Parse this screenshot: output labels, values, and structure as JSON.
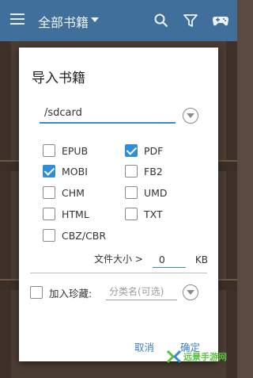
{
  "appbar": {
    "title": "全部书籍",
    "icons": [
      "menu-icon",
      "search-icon",
      "filter-icon",
      "gamepad-icon"
    ],
    "color": "#3f6f9a"
  },
  "dialog": {
    "title": "导入书籍",
    "path_value": "/sdcard",
    "formats": [
      {
        "label": "EPUB",
        "checked": false
      },
      {
        "label": "PDF",
        "checked": true
      },
      {
        "label": "MOBI",
        "checked": true
      },
      {
        "label": "FB2",
        "checked": false
      },
      {
        "label": "CHM",
        "checked": false
      },
      {
        "label": "UMD",
        "checked": false
      },
      {
        "label": "HTML",
        "checked": false
      },
      {
        "label": "TXT",
        "checked": false
      },
      {
        "label": "CBZ/CBR",
        "checked": false
      }
    ],
    "file_size_label": "文件大小 >",
    "file_size_value": "0",
    "file_size_unit": "KB",
    "favorite_label": "加入珍藏:",
    "favorite_checked": false,
    "category_placeholder": "分类名(可选)",
    "cancel_label": "取消",
    "ok_label": "确定",
    "accent_color": "#2f8ed6"
  },
  "watermark": {
    "text": "远景手游网"
  }
}
